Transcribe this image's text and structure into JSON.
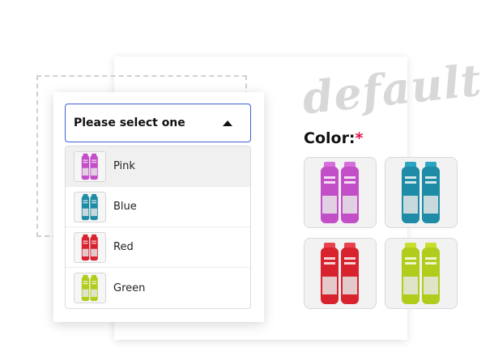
{
  "background": {
    "watermark": "default",
    "color_label": "Color:",
    "required_mark": "*",
    "swatches": [
      {
        "name": "Pink",
        "color": "#c34fc8",
        "cap": "#d66fd9"
      },
      {
        "name": "Blue",
        "color": "#1e8ca6",
        "cap": "#2aa6c2"
      },
      {
        "name": "Red",
        "color": "#d8232f",
        "cap": "#e94350"
      },
      {
        "name": "Green",
        "color": "#b2cc1c",
        "cap": "#c8df2e"
      }
    ]
  },
  "select": {
    "label": "Please select one",
    "accent": "#3d5fd6",
    "options": [
      {
        "label": "Pink",
        "color": "#c34fc8"
      },
      {
        "label": "Blue",
        "color": "#1e8ca6"
      },
      {
        "label": "Red",
        "color": "#d8232f"
      },
      {
        "label": "Green",
        "color": "#b2cc1c"
      }
    ]
  }
}
